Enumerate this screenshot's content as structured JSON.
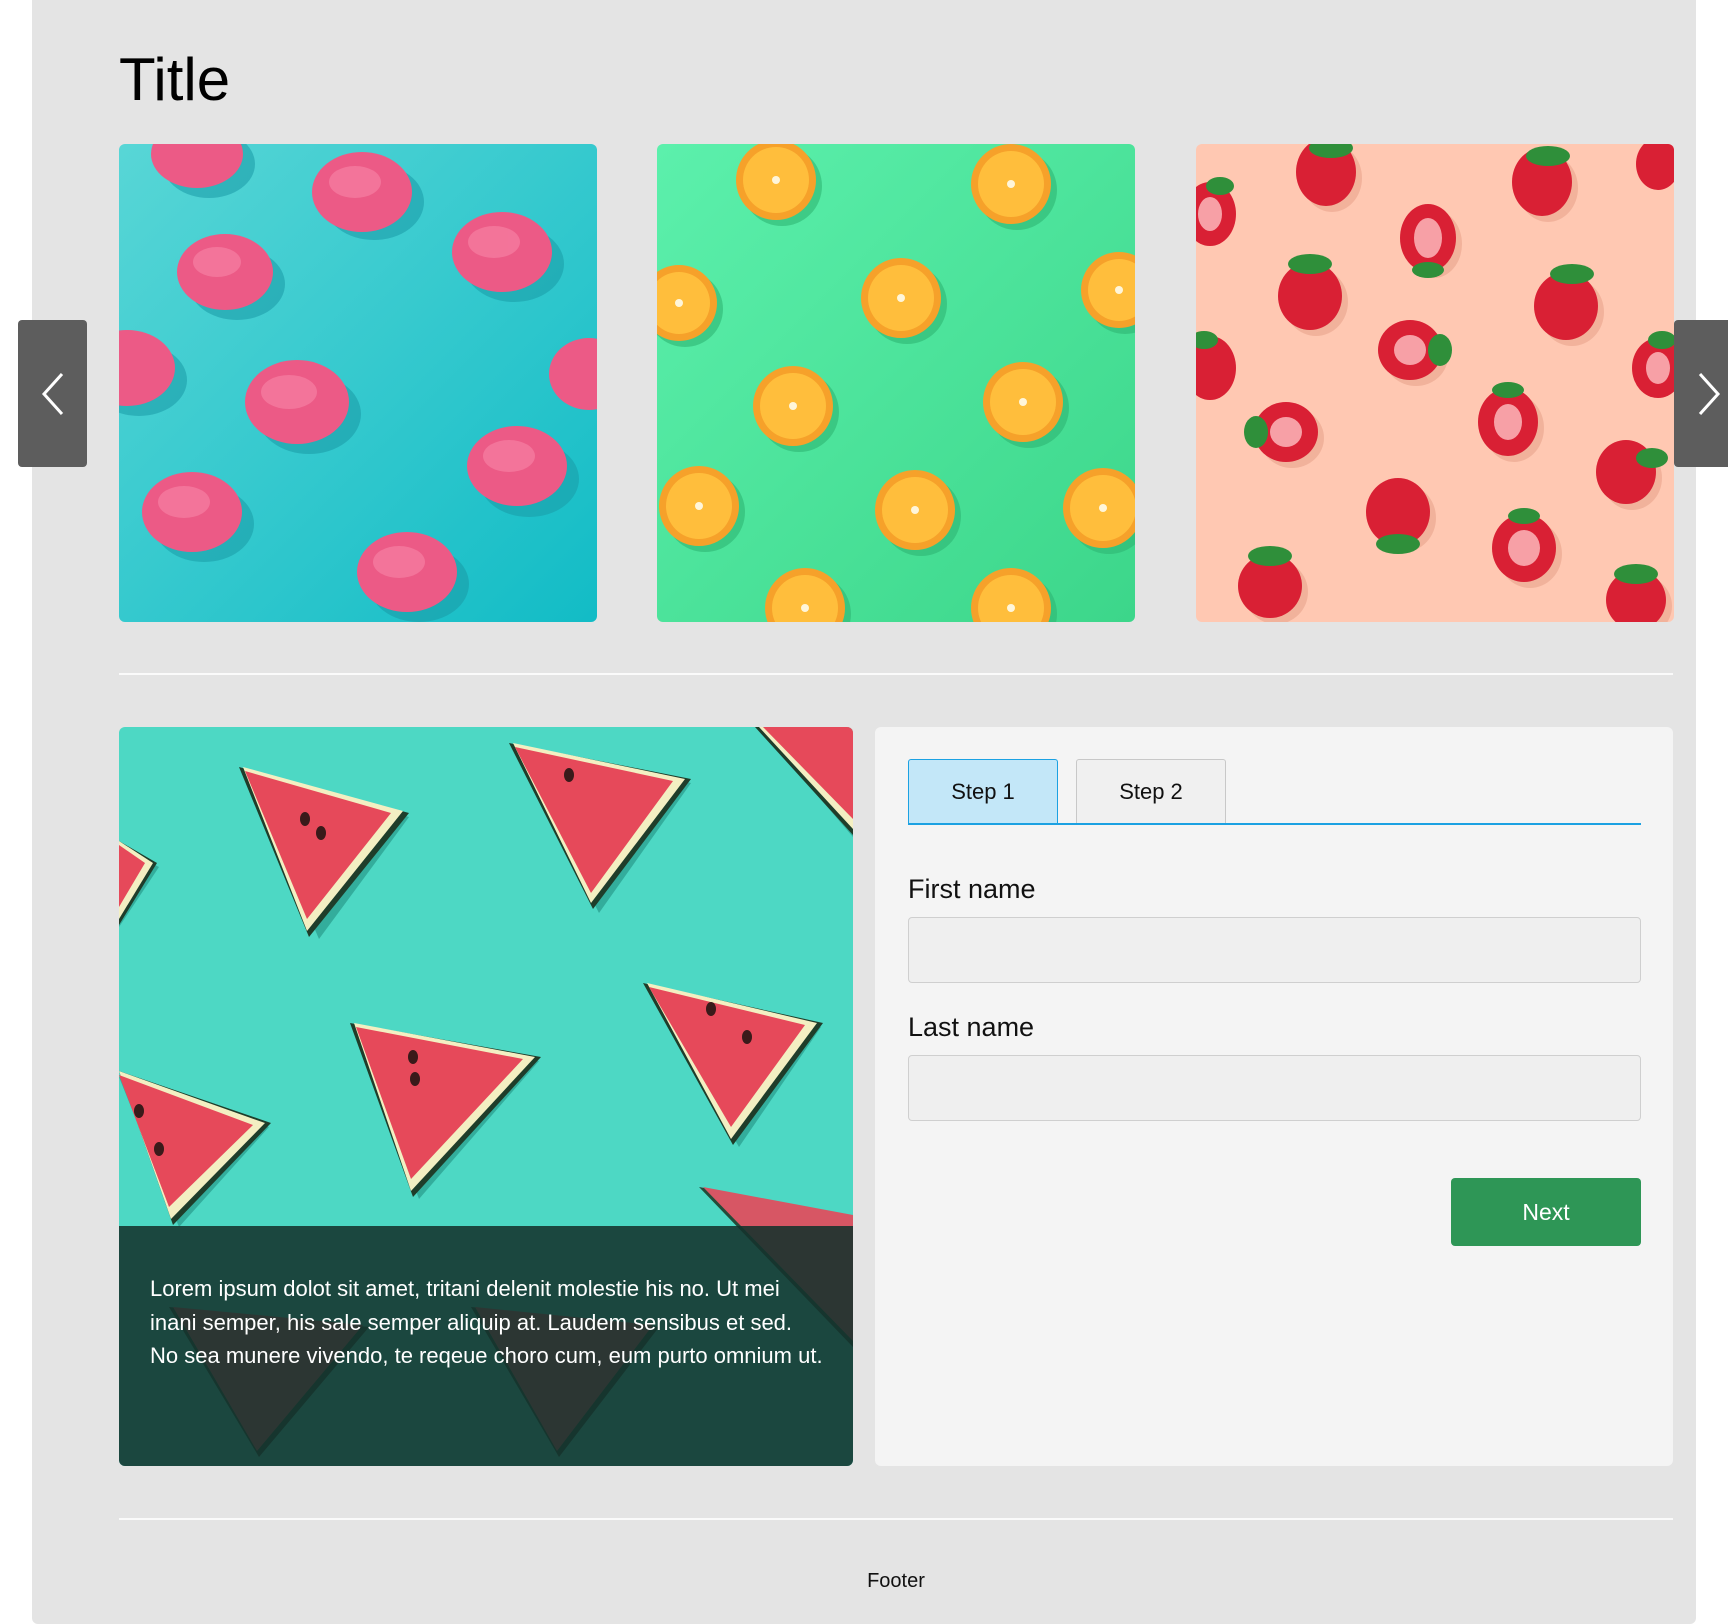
{
  "page": {
    "title": "Title",
    "footer": "Footer",
    "background_color": "#e4e4e4"
  },
  "carousel": {
    "prev_icon": "chevron-left-icon",
    "next_icon": "chevron-right-icon",
    "images": [
      {
        "name": "ice-cream-image",
        "background_color": "#22c2cc"
      },
      {
        "name": "orange-slices-image",
        "background_color": "#52e8a0"
      },
      {
        "name": "strawberries-image",
        "background_color": "#ffc9b0"
      }
    ]
  },
  "feature": {
    "image_name": "watermelon-image",
    "background_color": "#4dd8c4",
    "caption": "Lorem ipsum dolot sit amet, tritani delenit molestie his no. Ut mei inani semper, his sale semper aliquip at. Laudem sensibus et sed. No sea munere vivendo, te reqeue choro cum, eum purto omnium ut."
  },
  "form": {
    "tabs": [
      {
        "label": "Step 1",
        "active": true
      },
      {
        "label": "Step 2",
        "active": false
      }
    ],
    "first_name": {
      "label": "First name",
      "value": "",
      "placeholder": ""
    },
    "last_name": {
      "label": "Last name",
      "value": "",
      "placeholder": ""
    },
    "next_label": "Next",
    "accent_color": "#1ba1e2",
    "button_color": "#2e9656"
  }
}
